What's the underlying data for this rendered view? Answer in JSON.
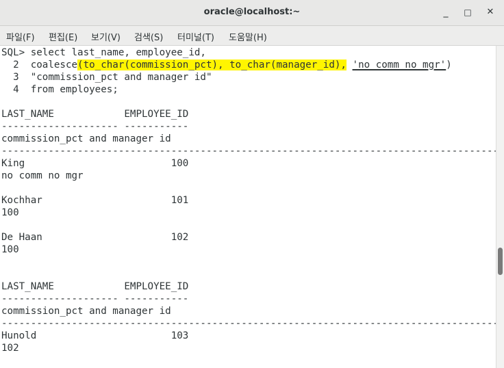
{
  "window": {
    "title": "oracle@localhost:~",
    "buttons": {
      "minimize": "_",
      "maximize": "□",
      "close": "✕"
    }
  },
  "menu": [
    {
      "label": "파일(F)"
    },
    {
      "label": "편집(E)"
    },
    {
      "label": "보기(V)"
    },
    {
      "label": "검색(S)"
    },
    {
      "label": "터미널(T)"
    },
    {
      "label": "도움말(H)"
    }
  ],
  "terminal": {
    "query": {
      "line1": "SQL> select last_name, employee_id,",
      "line2_prefix": "  2  coalesce",
      "line2_hl1": "(to_char(commission_pct), ",
      "line2_hl2": "to_char(manager_id),",
      "line2_gap": " ",
      "line2_literal": "'no comm no mgr'",
      "line2_close": ")",
      "line3": "  3  \"commission_pct and manager id\"",
      "line4": "  4  from employees;"
    },
    "block1": {
      "header1": "LAST_NAME            EMPLOYEE_ID",
      "sep1": "-------------------- -----------",
      "header2": "commission_pct and manager id",
      "sep2": "------------------------------------------------------------------------------------------------",
      "rows": [
        {
          "name_line": "King                         100",
          "value": "no comm no mgr"
        },
        {
          "name_line": "Kochhar                      101",
          "value": "100"
        },
        {
          "name_line": "De Haan                      102",
          "value": "100"
        }
      ]
    },
    "block2": {
      "header1": "LAST_NAME            EMPLOYEE_ID",
      "sep1": "-------------------- -----------",
      "header2": "commission_pct and manager id",
      "sep2": "------------------------------------------------------------------------------------------------",
      "rows": [
        {
          "name_line": "Hunold                       103",
          "value": "102"
        }
      ]
    }
  },
  "colors": {
    "highlight": "#fff500",
    "text": "#2e3436",
    "titlebar": "#e8e8e7"
  }
}
